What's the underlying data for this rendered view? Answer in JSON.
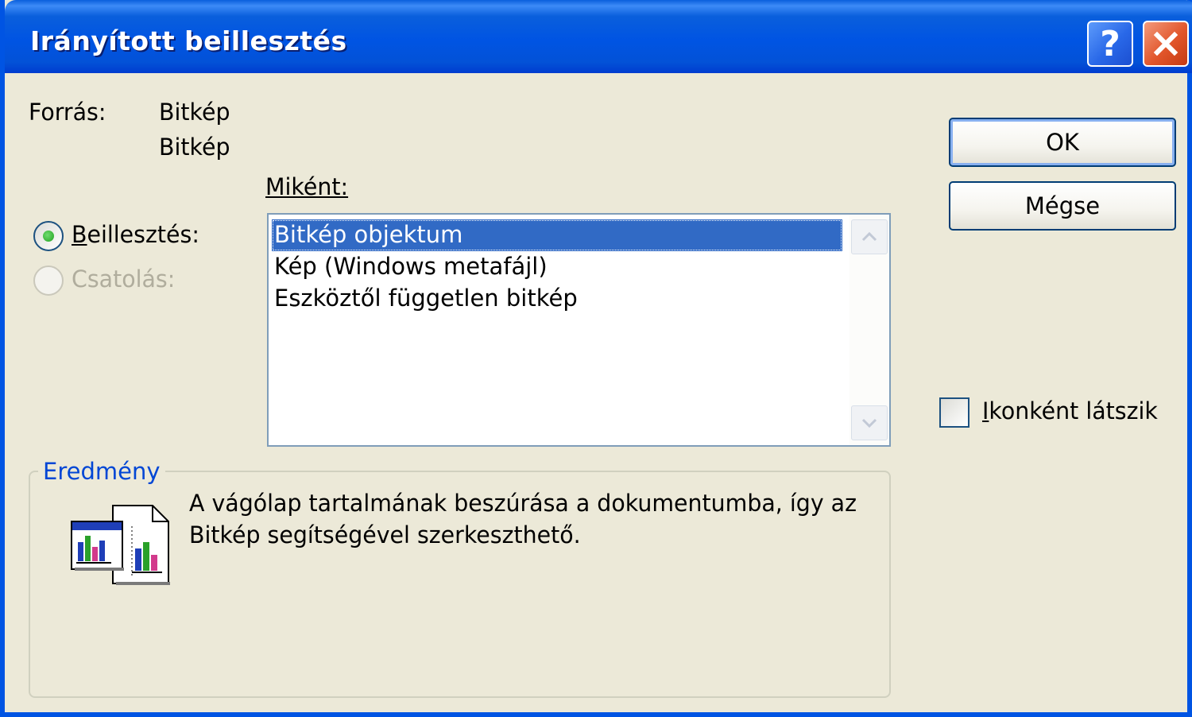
{
  "window": {
    "title": "Irányított beillesztés",
    "help_glyph": "?",
    "close_glyph": "close-icon"
  },
  "source": {
    "label": "Forrás:",
    "line1": "Bitkép",
    "line2": "Bitkép"
  },
  "as_label": "Miként:",
  "radios": {
    "paste": {
      "label_first": "B",
      "label_rest": "eillesztés:",
      "checked": true
    },
    "link": {
      "label": "Csatolás:",
      "disabled": true
    }
  },
  "list": {
    "items": [
      "Bitkép objektum",
      "Kép (Windows metafájl)",
      "Eszköztől független bitkép"
    ],
    "selected_index": 0
  },
  "buttons": {
    "ok": "OK",
    "cancel": "Mégse"
  },
  "icon_checkbox": {
    "label_first": "I",
    "label_rest": "konként látszik",
    "checked": false
  },
  "result": {
    "legend": "Eredmény",
    "line1": "A vágólap tartalmának beszúrása a dokumentumba, így az",
    "line2": "Bitkép segítségével szerkeszthető."
  },
  "colors": {
    "titlebar": "#0054e3",
    "selection": "#316ac5",
    "dialog_bg": "#ece9d8",
    "group_legend": "#0046d5"
  }
}
